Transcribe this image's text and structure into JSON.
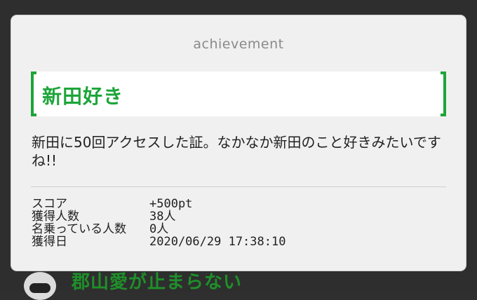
{
  "modal": {
    "kicker": "achievement",
    "title": "新田好き",
    "description": "新田に50回アクセスした証。なかなか新田のこと好きみたいですね!!",
    "meta": [
      {
        "label": "スコア",
        "value": "+500pt"
      },
      {
        "label": "獲得人数",
        "value": "38人"
      },
      {
        "label": "名乗っている人数",
        "value": "0人"
      },
      {
        "label": "獲得日",
        "value": "2020/06/29 17:38:10"
      }
    ]
  },
  "background": {
    "title": "郡山愛が止まらない"
  },
  "colors": {
    "accent": "#1da53a",
    "overlay": "#2e2e2e",
    "modal_bg": "#f0f0f0"
  }
}
